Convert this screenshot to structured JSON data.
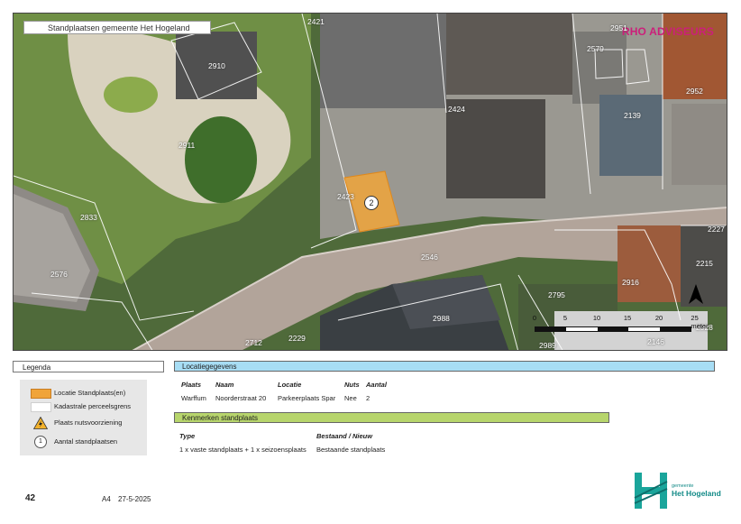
{
  "map": {
    "title": "Standplaatsen gemeente Het Hogeland",
    "brand": "RHO ADVISEURS",
    "parcel_numbers": [
      "2421",
      "2910",
      "2951",
      "2579",
      "2952",
      "2424",
      "2139",
      "2911",
      "2423",
      "2833",
      "2227",
      "2546",
      "2215",
      "2576",
      "2916",
      "2795",
      "2988",
      "2928",
      "2712",
      "2229",
      "2989",
      "2146"
    ],
    "site_marker": "2",
    "scale": {
      "ticks": [
        "0",
        "5",
        "10",
        "15",
        "20"
      ],
      "unit_label": "25 meter"
    },
    "colors": {
      "site_fill": "#f0a43a",
      "north_arrow": "#000000"
    }
  },
  "legend": {
    "title": "Legenda",
    "items": [
      {
        "label": "Locatie Standplaats(en)",
        "icon": "orange-swatch"
      },
      {
        "label": "Kadastrale perceelsgrens",
        "icon": "white-swatch"
      },
      {
        "label": "Plaats nutsvoorziening",
        "icon": "warning-electric-icon"
      },
      {
        "label": "Aantal standplaatsen",
        "icon": "count-circle-icon",
        "symbol": "1"
      }
    ]
  },
  "location": {
    "header": "Locatiegegevens",
    "columns": [
      "Plaats",
      "Naam",
      "Locatie",
      "Nuts",
      "Aantal"
    ],
    "row": [
      "Warffum",
      "Noorderstraat 20",
      "Parkeerplaats Spar",
      "Nee",
      "2"
    ]
  },
  "characteristics": {
    "header": "Kenmerken standplaats",
    "columns": [
      "Type",
      "Bestaand / Nieuw"
    ],
    "row": [
      "1 x vaste standplaats + 1 x seizoensplaats",
      "Bestaande standplaats"
    ]
  },
  "footer": {
    "page_number": "42",
    "paper_size": "A4",
    "date": "27-5-2025",
    "logo_small": "gemeente",
    "logo_big": "Het Hogeland"
  }
}
